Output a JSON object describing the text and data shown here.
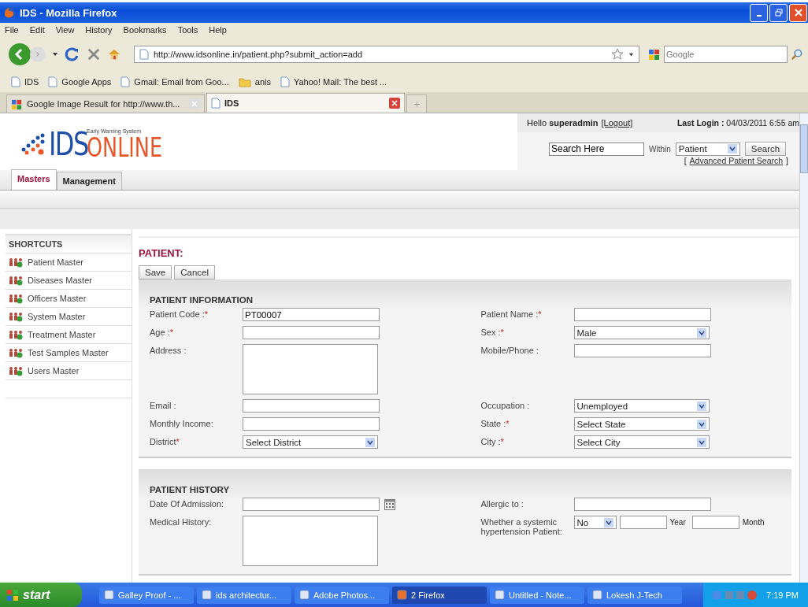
{
  "window": {
    "title": "IDS - Mozilla Firefox"
  },
  "menu": [
    "File",
    "Edit",
    "View",
    "History",
    "Bookmarks",
    "Tools",
    "Help"
  ],
  "nav": {
    "url": "http://www.idsonline.in/patient.php?submit_action=add",
    "search_placeholder": "Google"
  },
  "bookmarks": [
    {
      "label": "IDS",
      "kind": "page"
    },
    {
      "label": "Google Apps",
      "kind": "page"
    },
    {
      "label": "Gmail: Email from Goo...",
      "kind": "page"
    },
    {
      "label": "anis",
      "kind": "folder"
    },
    {
      "label": "Yahoo! Mail: The best ...",
      "kind": "page"
    }
  ],
  "browser_tabs": [
    {
      "label": "Google Image Result for http://www.th...",
      "selected": false,
      "kind": "google"
    },
    {
      "label": "IDS",
      "selected": true,
      "kind": "page"
    }
  ],
  "header": {
    "logo": {
      "mark": "IDS",
      "word": "ONLINE",
      "tagline": "Early Warning System"
    },
    "greeting": "Hello",
    "user": "superadmin",
    "logout": "[Logout]",
    "last_login_label": "Last Login :",
    "last_login": "04/03/2011 6:55 am",
    "search_value": "Search Here",
    "within": "Within",
    "scope": "Patient",
    "search_button": "Search",
    "bracket_open": "[",
    "advanced": "Advanced Patient Search",
    "bracket_close": "]"
  },
  "app_tabs": [
    {
      "label": "Masters",
      "selected": true
    },
    {
      "label": "Management",
      "selected": false
    }
  ],
  "sidebar": {
    "title": "SHORTCUTS",
    "items": [
      "Patient Master",
      "Diseases Master",
      "Officers Master",
      "System Master",
      "Treatment Master",
      "Test Samples Master",
      "Users Master"
    ]
  },
  "page_title": "PATIENT:",
  "buttons": [
    "Save",
    "Cancel"
  ],
  "sections": [
    {
      "title": "PATIENT INFORMATION",
      "rows": [
        [
          {
            "label": "Patient Code :",
            "mark": "*",
            "kind": "text",
            "value": "PT00007"
          },
          {
            "label": "Patient Name :",
            "mark": "*",
            "kind": "text"
          }
        ],
        [
          {
            "label": "Age :",
            "mark": "*",
            "kind": "text"
          },
          {
            "label": "Sex :",
            "mark": "*",
            "kind": "select",
            "value": "Male"
          }
        ],
        [
          {
            "label": "Address :",
            "kind": "textarea"
          },
          {
            "label": "Mobile/Phone :",
            "kind": "text"
          }
        ],
        [
          {
            "label": "Email :",
            "kind": "text"
          },
          {
            "label": "Occupation :",
            "kind": "select",
            "value": "Unemployed"
          }
        ],
        [
          {
            "label": "Monthly Income:",
            "kind": "text"
          },
          {
            "label": "State :",
            "mark": "*",
            "kind": "select",
            "value": "Select State"
          }
        ],
        [
          {
            "label": "District",
            "mark": "*",
            "kind": "select",
            "value": "Select District"
          },
          {
            "label": "City :",
            "mark": "*",
            "kind": "select",
            "value": "Select City"
          }
        ]
      ]
    },
    {
      "title": "PATIENT HISTORY",
      "rows": [
        [
          {
            "label": "Date Of Admission:",
            "kind": "date"
          },
          {
            "label": "Allergic to :",
            "kind": "text"
          }
        ],
        [
          {
            "label": "Medical History:",
            "kind": "textarea"
          },
          {
            "label": "Whether a systemic hypertension Patient:",
            "kind": "duration",
            "value": "No",
            "year": "Year",
            "month": "Month"
          }
        ]
      ]
    }
  ],
  "taskbar": {
    "start": "start",
    "items": [
      {
        "label": "Galley Proof - ...",
        "selected": false
      },
      {
        "label": "ids architectur...",
        "selected": false
      },
      {
        "label": "Adobe Photos...",
        "selected": false
      },
      {
        "label": "2 Firefox",
        "selected": true
      },
      {
        "label": "Untitled - Note...",
        "selected": false
      },
      {
        "label": "Lokesh J-Tech",
        "selected": false
      }
    ],
    "time": "7:19 PM"
  }
}
